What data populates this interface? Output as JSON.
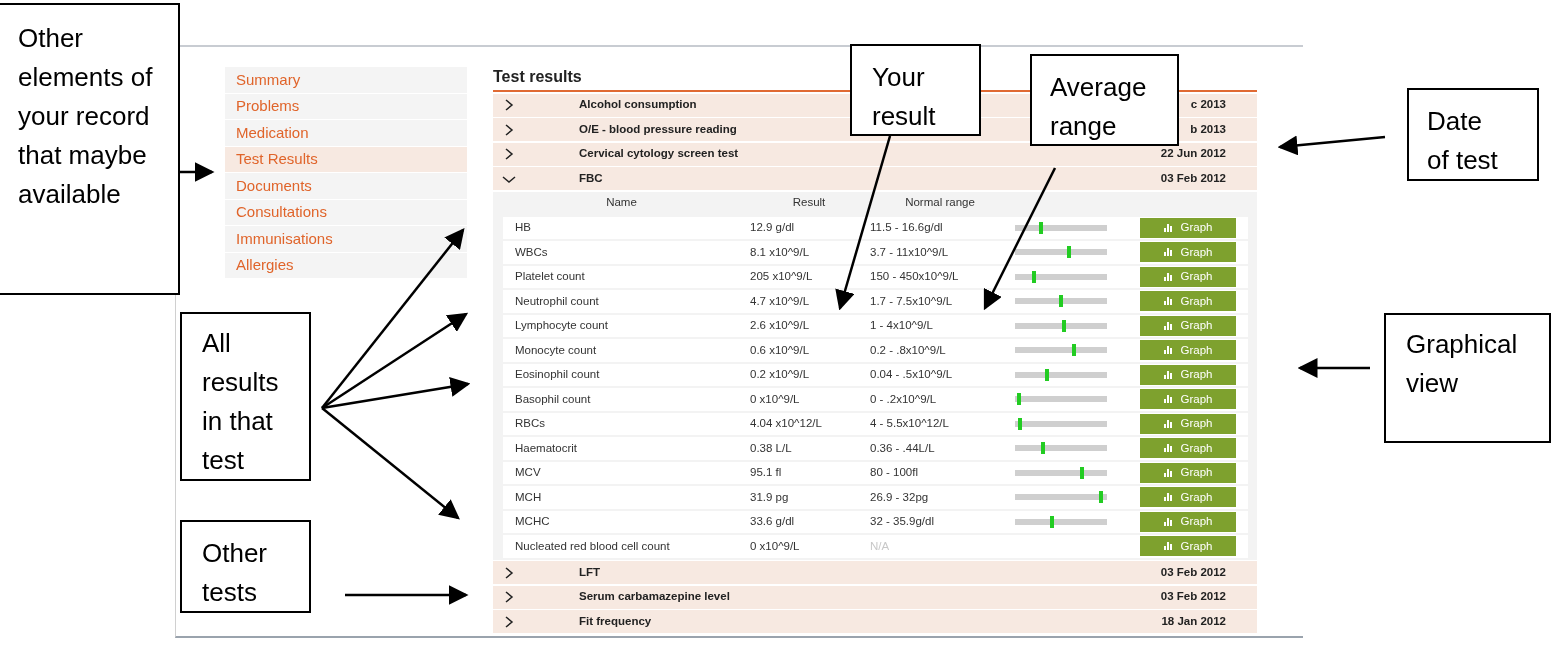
{
  "sidebar": {
    "items": [
      {
        "label": "Summary",
        "selected": false
      },
      {
        "label": "Problems",
        "selected": false
      },
      {
        "label": "Medication",
        "selected": false
      },
      {
        "label": "Test Results",
        "selected": true
      },
      {
        "label": "Documents",
        "selected": false
      },
      {
        "label": "Consultations",
        "selected": false
      },
      {
        "label": "Immunisations",
        "selected": false
      },
      {
        "label": "Allergies",
        "selected": false
      }
    ]
  },
  "main": {
    "title": "Test results",
    "tests": [
      {
        "name": "Alcohol consumption",
        "date": "c 2013",
        "expanded": false
      },
      {
        "name": "O/E - blood pressure reading",
        "date": "b 2013",
        "expanded": false
      },
      {
        "name": "Cervical cytology screen test",
        "date": "22 Jun 2012",
        "expanded": false
      },
      {
        "name": "FBC",
        "date": "03 Feb 2012",
        "expanded": true,
        "columns": [
          "Name",
          "Result",
          "Normal range"
        ],
        "rows": [
          {
            "name": "HB",
            "result": "12.9 g/dl",
            "range": "11.5 - 16.6g/dl",
            "range_greyed": false,
            "level": 0.27,
            "button": "Graph"
          },
          {
            "name": "WBCs",
            "result": "8.1 x10^9/L",
            "range": "3.7 - 11x10^9/L",
            "range_greyed": false,
            "level": 0.59,
            "button": "Graph"
          },
          {
            "name": "Platelet count",
            "result": "205 x10^9/L",
            "range": "150 - 450x10^9/L",
            "range_greyed": false,
            "level": 0.19,
            "button": "Graph"
          },
          {
            "name": "Neutrophil count",
            "result": "4.7 x10^9/L",
            "range": "1.7 - 7.5x10^9/L",
            "range_greyed": false,
            "level": 0.5,
            "button": "Graph"
          },
          {
            "name": "Lymphocyte count",
            "result": "2.6 x10^9/L",
            "range": "1 - 4x10^9/L",
            "range_greyed": false,
            "level": 0.53,
            "button": "Graph"
          },
          {
            "name": "Monocyte count",
            "result": "0.6 x10^9/L",
            "range": "0.2 - .8x10^9/L",
            "range_greyed": false,
            "level": 0.65,
            "button": "Graph"
          },
          {
            "name": "Eosinophil count",
            "result": "0.2 x10^9/L",
            "range": "0.04 - .5x10^9/L",
            "range_greyed": false,
            "level": 0.34,
            "button": "Graph"
          },
          {
            "name": "Basophil count",
            "result": "0 x10^9/L",
            "range": "0 - .2x10^9/L",
            "range_greyed": false,
            "level": 0.02,
            "button": "Graph"
          },
          {
            "name": "RBCs",
            "result": "4.04 x10^12/L",
            "range": "4 - 5.5x10^12/L",
            "range_greyed": false,
            "level": 0.03,
            "button": "Graph"
          },
          {
            "name": "Haematocrit",
            "result": "0.38 L/L",
            "range": "0.36 - .44L/L",
            "range_greyed": false,
            "level": 0.29,
            "button": "Graph"
          },
          {
            "name": "MCV",
            "result": "95.1 fl",
            "range": "80 - 100fl",
            "range_greyed": false,
            "level": 0.74,
            "button": "Graph"
          },
          {
            "name": "MCH",
            "result": "31.9 pg",
            "range": "26.9 - 32pg",
            "range_greyed": false,
            "level": 0.95,
            "button": "Graph"
          },
          {
            "name": "MCHC",
            "result": "33.6 g/dl",
            "range": "32 - 35.9g/dl",
            "range_greyed": false,
            "level": 0.4,
            "button": "Graph"
          },
          {
            "name": "Nucleated red blood cell count",
            "result": "0 x10^9/L",
            "range": "N/A",
            "range_greyed": true,
            "button": "Graph"
          }
        ]
      },
      {
        "name": "LFT",
        "date": "03 Feb 2012",
        "expanded": false
      },
      {
        "name": "Serum carbamazepine level",
        "date": "03 Feb 2012",
        "expanded": false
      },
      {
        "name": "Fit frequency",
        "date": "18 Jan 2012",
        "expanded": false
      }
    ]
  },
  "callouts": [
    {
      "text": "Other elements of your record that maybe available"
    },
    {
      "text": "Your result"
    },
    {
      "text": "Average range"
    },
    {
      "text": "Date of test"
    },
    {
      "text": "All results in that test"
    },
    {
      "text": "Graphical view"
    },
    {
      "text": "Other tests"
    }
  ]
}
